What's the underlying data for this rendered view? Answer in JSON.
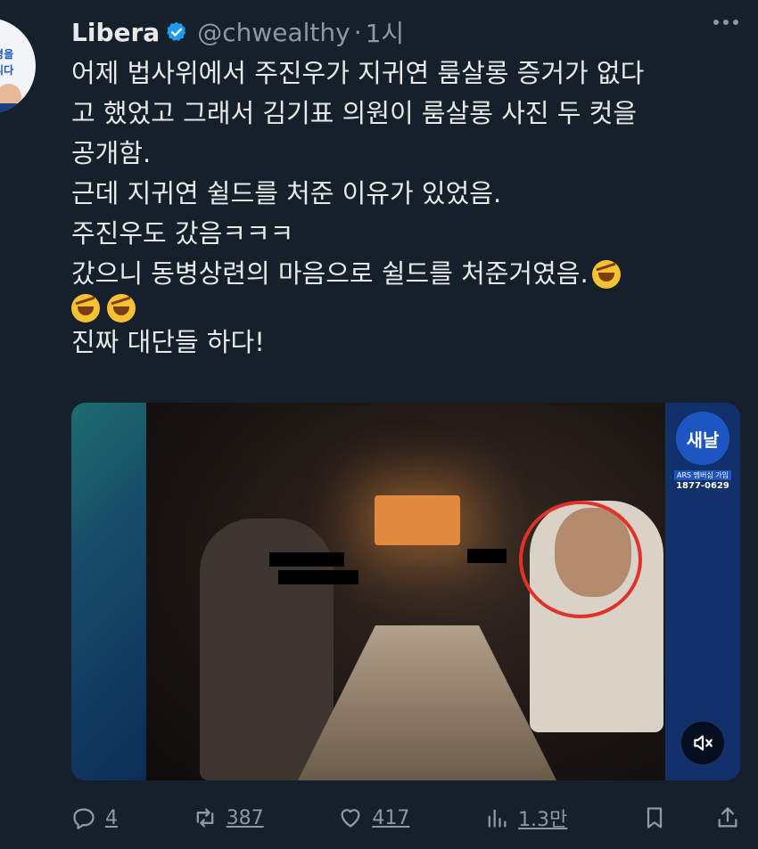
{
  "tweet": {
    "author_name": "Libera",
    "handle": "@chwealthy",
    "separator": "·",
    "time": "1시",
    "lines": [
      "어제 법사위에서 주진우가 지귀연 룸살롱 증거가 없다",
      "고 했었고 그래서 김기표 의원이 룸살롱 사진 두 컷을",
      "공개함.",
      "근데 지귀연 쉴드를 처준 이유가 있었음.",
      "주진우도 갔음ㅋㅋㅋ",
      "갔으니 동병상련의 마음으로 쉴드를 처준거였음.",
      "",
      "진짜 대단들 하다!"
    ],
    "emoji": "rolling-on-floor-laughing"
  },
  "avatar": {
    "text_line1": "재명을",
    "text_line2": "합니다"
  },
  "media": {
    "logo": "새날",
    "logo_sub1": "ARS 멤버십 가입",
    "logo_sub2": "1877-0629",
    "mute_icon": "volume-muted-icon"
  },
  "actions": {
    "replies": "4",
    "reposts": "387",
    "likes": "417",
    "views": "1.3만"
  },
  "colors": {
    "background": "#15202b",
    "text": "#e7e9ea",
    "muted": "#8b98a5",
    "verified": "#1d9bf0",
    "highlight_circle": "#e0312b"
  }
}
